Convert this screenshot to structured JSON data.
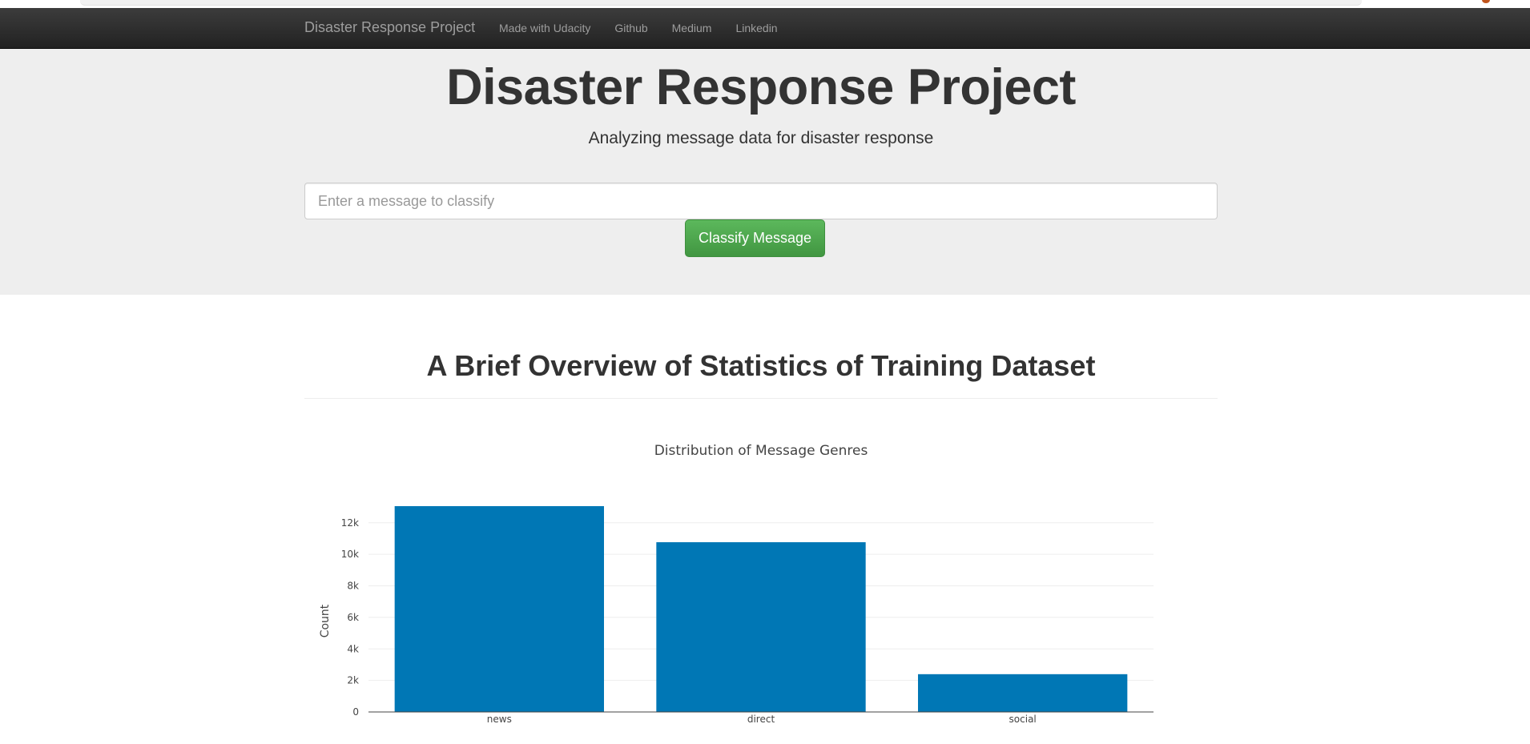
{
  "navbar": {
    "brand": "Disaster Response Project",
    "links": [
      "Made with Udacity",
      "Github",
      "Medium",
      "Linkedin"
    ]
  },
  "hero": {
    "title": "Disaster Response Project",
    "subtitle": "Analyzing message data for disaster response",
    "input_placeholder": "Enter a message to classify",
    "button_label": "Classify Message"
  },
  "section": {
    "title": "A Brief Overview of Statistics of Training Dataset"
  },
  "colors": {
    "bar": "#0077b5",
    "grid": "#eeeeee",
    "axis": "#444444"
  },
  "chart_data": {
    "type": "bar",
    "title": "Distribution of Message Genres",
    "xlabel": "",
    "ylabel": "Count",
    "categories": [
      "news",
      "direct",
      "social"
    ],
    "values": [
      13054,
      10766,
      2396
    ],
    "ylim": [
      0,
      13054
    ],
    "yticks": [
      0,
      2000,
      4000,
      6000,
      8000,
      10000,
      12000
    ],
    "ytick_labels": [
      "0",
      "2k",
      "4k",
      "6k",
      "8k",
      "10k",
      "12k"
    ],
    "grid": true,
    "legend": "none"
  }
}
